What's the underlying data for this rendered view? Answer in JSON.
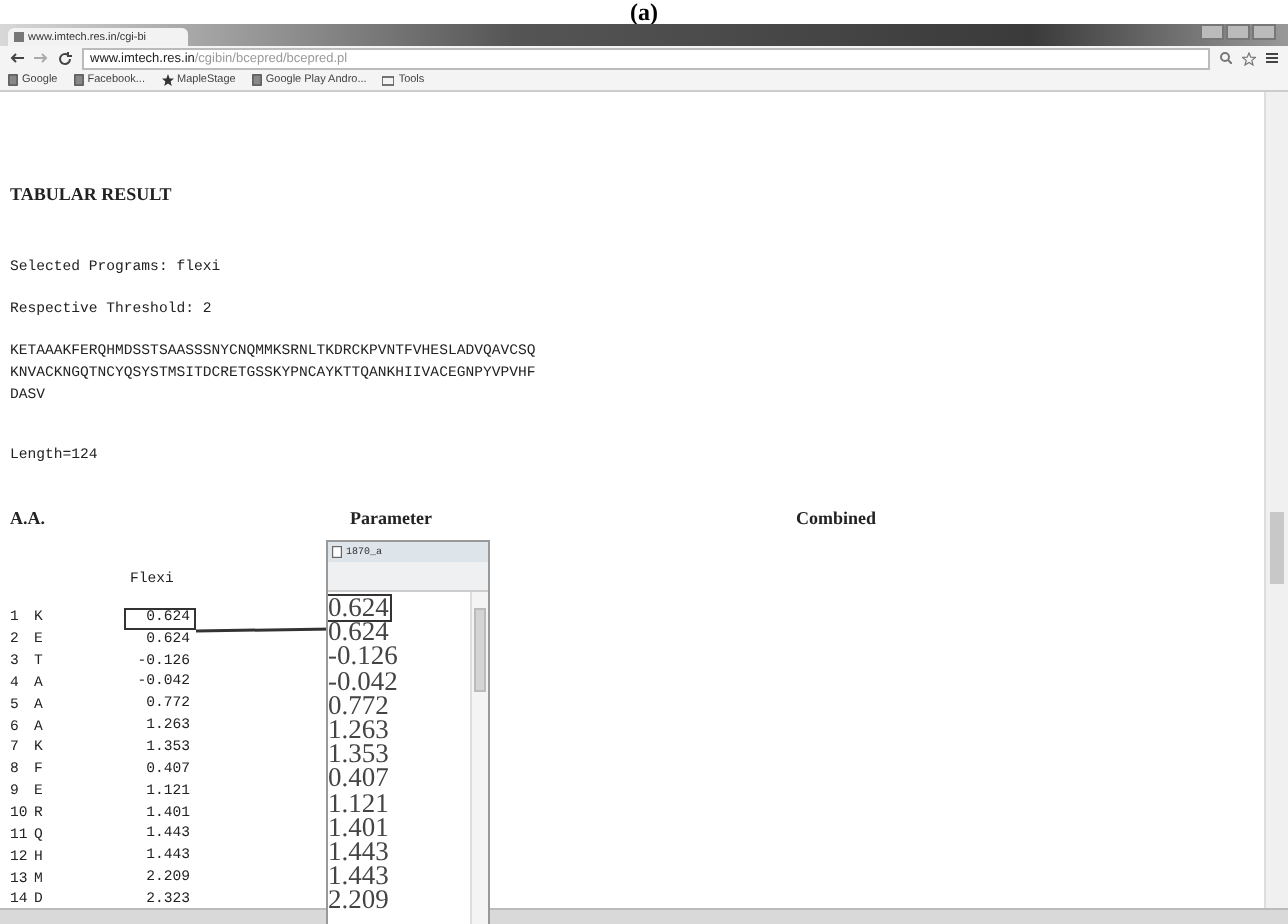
{
  "figure_label": "(a)",
  "browser": {
    "tab_title": "www.imtech.res.in/cgi-bi",
    "url_host": "www.imtech.res.in",
    "url_path": "/cgibin/bcepred/bcepred.pl",
    "bookmarks": [
      {
        "label": "Google",
        "kind": "page"
      },
      {
        "label": "Facebook...",
        "kind": "page"
      },
      {
        "label": "MapleStage",
        "kind": "star"
      },
      {
        "label": "Google Play Andro...",
        "kind": "page"
      },
      {
        "label": "Tools",
        "kind": "folder"
      }
    ]
  },
  "page": {
    "heading": "TABULAR RESULT",
    "selected_programs": "Selected Programs: flexi",
    "threshold": "Respective Threshold: 2",
    "sequence_lines": [
      "KETAAAKFERQHMDSSTSAASSSNYCNQMMKSRNLTKDRCKPVNTFVHESLADVQAVCSQ",
      "KNVACKNGQTNCYQSYSTMSITDCRETGSSKYPNCAYKTTQANKHIIVACEGNPYVPVHF",
      "DASV"
    ],
    "length": "Length=124",
    "columns": [
      "A.A.",
      "Parameter",
      "Combined"
    ],
    "flexi_header": "Flexi",
    "rows": [
      {
        "index": "1",
        "residue": "K",
        "value": "0.624",
        "highlighted": true
      },
      {
        "index": "2",
        "residue": "E",
        "value": "0.624",
        "highlighted": false
      },
      {
        "index": "3",
        "residue": "T",
        "value": "-0.126",
        "highlighted": false
      },
      {
        "index": "4",
        "residue": "A",
        "value": "-0.042",
        "highlighted": false
      },
      {
        "index": "5",
        "residue": "A",
        "value": "0.772",
        "highlighted": false
      },
      {
        "index": "6",
        "residue": "A",
        "value": "1.263",
        "highlighted": false
      },
      {
        "index": "7",
        "residue": "K",
        "value": "1.353",
        "highlighted": false
      },
      {
        "index": "8",
        "residue": "F",
        "value": "0.407",
        "highlighted": false
      },
      {
        "index": "9",
        "residue": "E",
        "value": "1.121",
        "highlighted": false
      },
      {
        "index": "10",
        "residue": "R",
        "value": "1.401",
        "highlighted": false
      },
      {
        "index": "11",
        "residue": "Q",
        "value": "1.443",
        "highlighted": false
      },
      {
        "index": "12",
        "residue": "H",
        "value": "1.443",
        "highlighted": false
      },
      {
        "index": "13",
        "residue": "M",
        "value": "2.209",
        "highlighted": false
      },
      {
        "index": "14",
        "residue": "D",
        "value": "2.323",
        "highlighted": false
      }
    ]
  },
  "notepad": {
    "title": "1870_a",
    "values": [
      {
        "text": "0.624",
        "highlighted": true
      },
      {
        "text": "0.624",
        "highlighted": false
      },
      {
        "text": "-0.126",
        "highlighted": false
      },
      {
        "text": "-0.042",
        "highlighted": false
      },
      {
        "text": "0.772",
        "highlighted": false
      },
      {
        "text": "1.263",
        "highlighted": false
      },
      {
        "text": "1.353",
        "highlighted": false
      },
      {
        "text": "0.407",
        "highlighted": false
      },
      {
        "text": "1.121",
        "highlighted": false
      },
      {
        "text": "1.401",
        "highlighted": false
      },
      {
        "text": "1.443",
        "highlighted": false
      },
      {
        "text": "1.443",
        "highlighted": false
      },
      {
        "text": "2.209",
        "highlighted": false
      }
    ]
  }
}
